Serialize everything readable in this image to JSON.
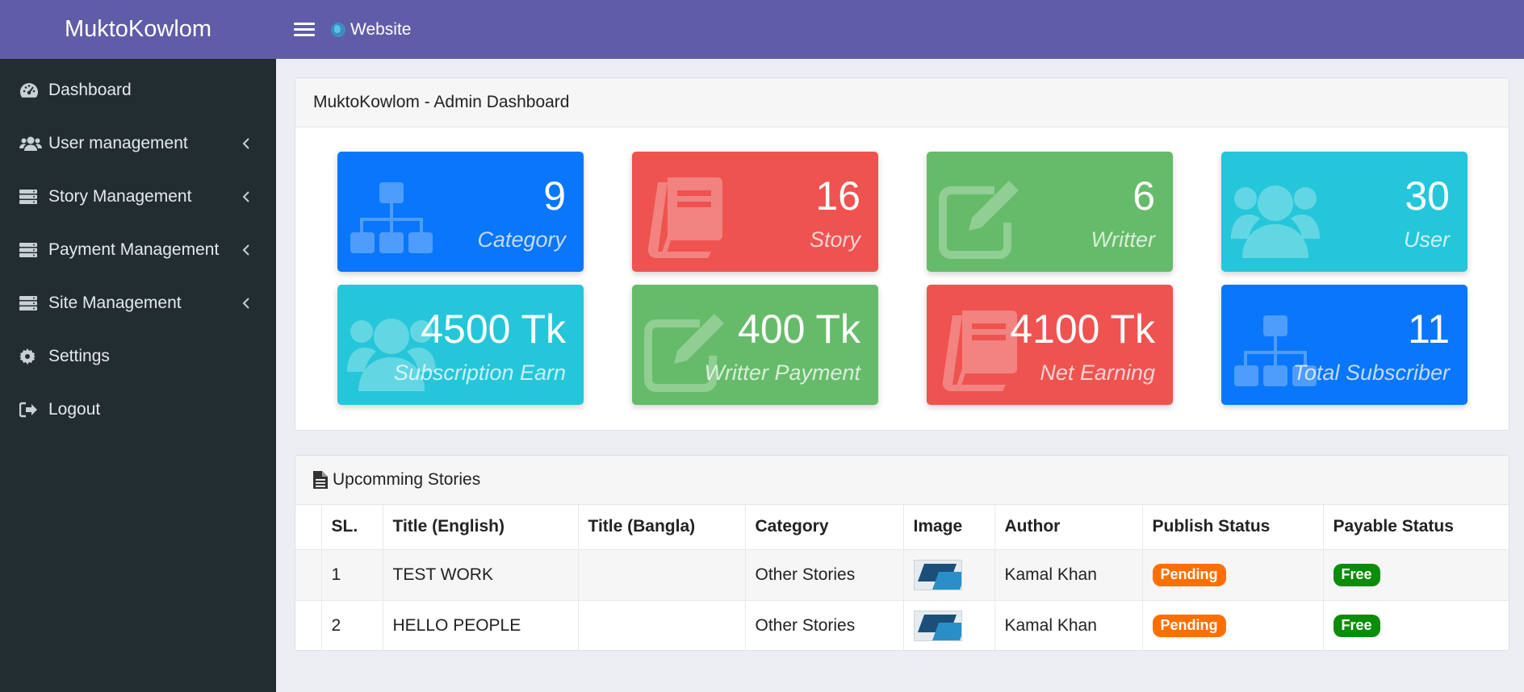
{
  "brand": "MuktoKowlom",
  "topbar": {
    "website_label": "Website"
  },
  "sidebar": {
    "items": [
      {
        "label": "Dashboard",
        "icon": "dashboard-icon",
        "has_submenu": false
      },
      {
        "label": "User management",
        "icon": "users-icon",
        "has_submenu": true
      },
      {
        "label": "Story Management",
        "icon": "server-icon",
        "has_submenu": true
      },
      {
        "label": "Payment Management",
        "icon": "server-icon",
        "has_submenu": true
      },
      {
        "label": "Site Management",
        "icon": "server-icon",
        "has_submenu": true
      },
      {
        "label": "Settings",
        "icon": "gear-icon",
        "has_submenu": false
      },
      {
        "label": "Logout",
        "icon": "sign-out-icon",
        "has_submenu": false
      }
    ]
  },
  "dashboard": {
    "title": "MuktoKowlom - Admin Dashboard",
    "stats": [
      {
        "value": "9",
        "label": "Category",
        "color": "#0a76fb",
        "icon": "sitemap-icon"
      },
      {
        "value": "16",
        "label": "Story",
        "color": "#ee5350",
        "icon": "book-icon"
      },
      {
        "value": "6",
        "label": "Writter",
        "color": "#66bb6a",
        "icon": "edit-icon"
      },
      {
        "value": "30",
        "label": "User",
        "color": "#26c6da",
        "icon": "users-icon"
      },
      {
        "value": "4500 Tk",
        "label": "Subscription Earn",
        "color": "#26c6da",
        "icon": "users-icon"
      },
      {
        "value": "400 Tk",
        "label": "Writter Payment",
        "color": "#66bb6a",
        "icon": "edit-icon"
      },
      {
        "value": "4100 Tk",
        "label": "Net Earning",
        "color": "#ee5350",
        "icon": "book-icon"
      },
      {
        "value": "11",
        "label": "Total Subscriber",
        "color": "#0a76fb",
        "icon": "sitemap-icon"
      }
    ]
  },
  "stories": {
    "title": "Upcomming Stories",
    "columns": [
      "SL.",
      "Title (English)",
      "Title (Bangla)",
      "Category",
      "Image",
      "Author",
      "Publish Status",
      "Payable Status"
    ],
    "rows": [
      {
        "sl": "1",
        "title_en": "TEST WORK",
        "title_bn": "",
        "category": "Other Stories",
        "author": "Kamal Khan",
        "publish_status": "Pending",
        "payable_status": "Free"
      },
      {
        "sl": "2",
        "title_en": "HELLO PEOPLE",
        "title_bn": "",
        "category": "Other Stories",
        "author": "Kamal Khan",
        "publish_status": "Pending",
        "payable_status": "Free"
      }
    ]
  }
}
